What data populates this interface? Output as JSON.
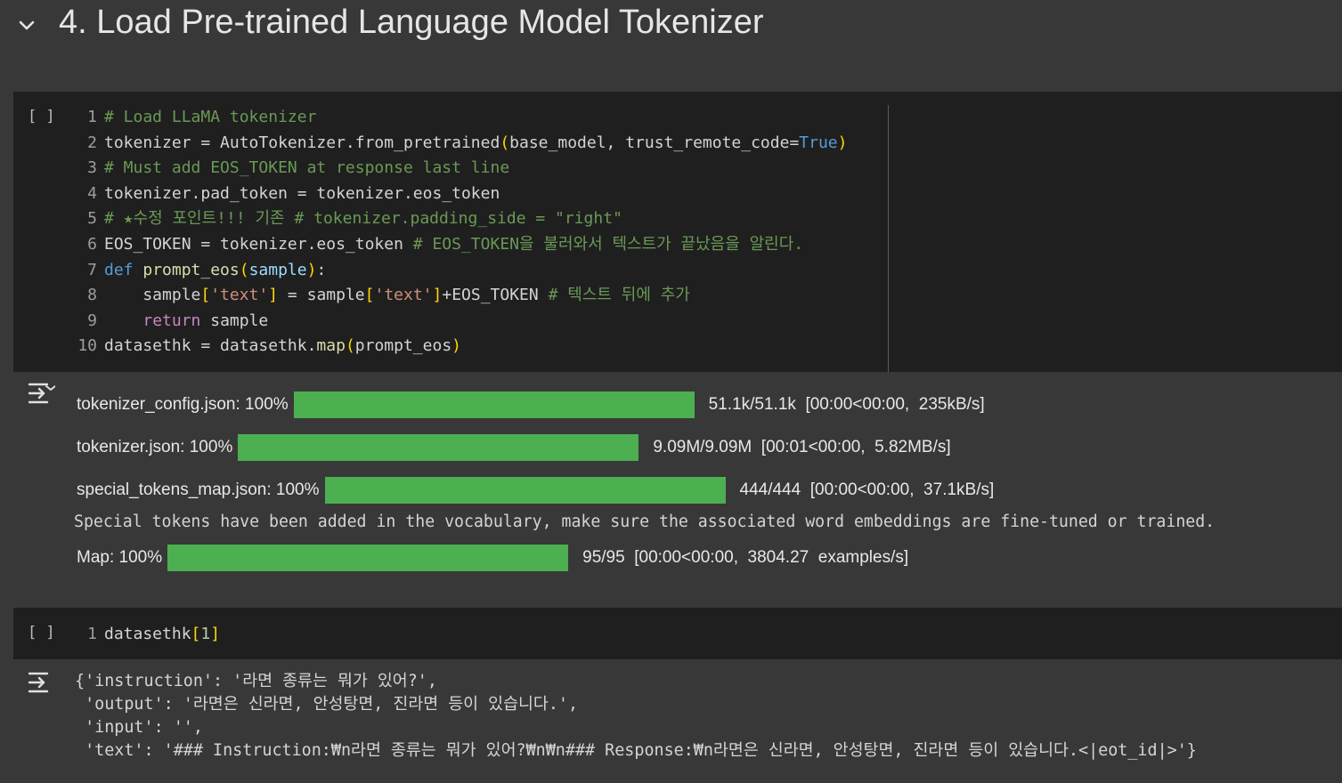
{
  "section": {
    "title": "4. Load Pre-trained Language Model Tokenizer",
    "collapse_icon": "chevron-down-icon"
  },
  "cell1": {
    "run_label": "[ ]",
    "lines": [
      {
        "n": "1",
        "text": "# Load LLaMA tokenizer"
      },
      {
        "n": "2",
        "text": "tokenizer = AutoTokenizer.from_pretrained(base_model, trust_remote_code=True)"
      },
      {
        "n": "3",
        "text": "# Must add EOS_TOKEN at response last line"
      },
      {
        "n": "4",
        "text": "tokenizer.pad_token = tokenizer.eos_token"
      },
      {
        "n": "5",
        "text": "# ★수정 포인트!!! 기존 # tokenizer.padding_side = \"right\""
      },
      {
        "n": "6",
        "text": "EOS_TOKEN = tokenizer.eos_token # EOS_TOKEN을 불러와서 텍스트가 끝났음을 알린다."
      },
      {
        "n": "7",
        "text": "def prompt_eos(sample):"
      },
      {
        "n": "8",
        "text": "    sample['text'] = sample['text']+EOS_TOKEN # 텍스트 뒤에 추가"
      },
      {
        "n": "9",
        "text": "    return sample"
      },
      {
        "n": "10",
        "text": "datasethk = datasethk.map(prompt_eos)"
      }
    ]
  },
  "output1": {
    "icon": "output-toggle-icon",
    "progress": [
      {
        "label": "tokenizer_config.json: 100%",
        "percent": 100,
        "stats": "51.1k/51.1k  [00:00<00:00,  235kB/s]"
      },
      {
        "label": "tokenizer.json: 100%",
        "percent": 100,
        "stats": "9.09M/9.09M  [00:01<00:00,  5.82MB/s]"
      },
      {
        "label": "special_tokens_map.json: 100%",
        "percent": 100,
        "stats": "444/444  [00:00<00:00,  37.1kB/s]"
      }
    ],
    "warning": "Special tokens have been added in the vocabulary, make sure the associated word embeddings are fine-tuned or trained.",
    "map": {
      "label": "Map: 100%",
      "percent": 100,
      "stats": "95/95  [00:00<00:00,  3804.27  examples/s]"
    }
  },
  "cell2": {
    "run_label": "[ ]",
    "lines": [
      {
        "n": "1",
        "text": "datasethk[1]"
      }
    ]
  },
  "output2": {
    "icon": "output-toggle-icon",
    "lines": [
      "{'instruction': '라면 종류는 뭐가 있어?',",
      " 'output': '라면은 신라면, 안성탕면, 진라면 등이 있습니다.',",
      " 'input': '',",
      " 'text': '### Instruction:₩n라면 종류는 뭐가 있어?₩n₩n### Response:₩n라면은 신라면, 안성탕면, 진라면 등이 있습니다.<|eot_id|>'}"
    ]
  },
  "colors": {
    "background": "#383838",
    "code_background": "#1f1f1f",
    "progress_fill": "#4caf50",
    "comment": "#6a9955",
    "keyword": "#569cd6",
    "string": "#ce9178"
  }
}
